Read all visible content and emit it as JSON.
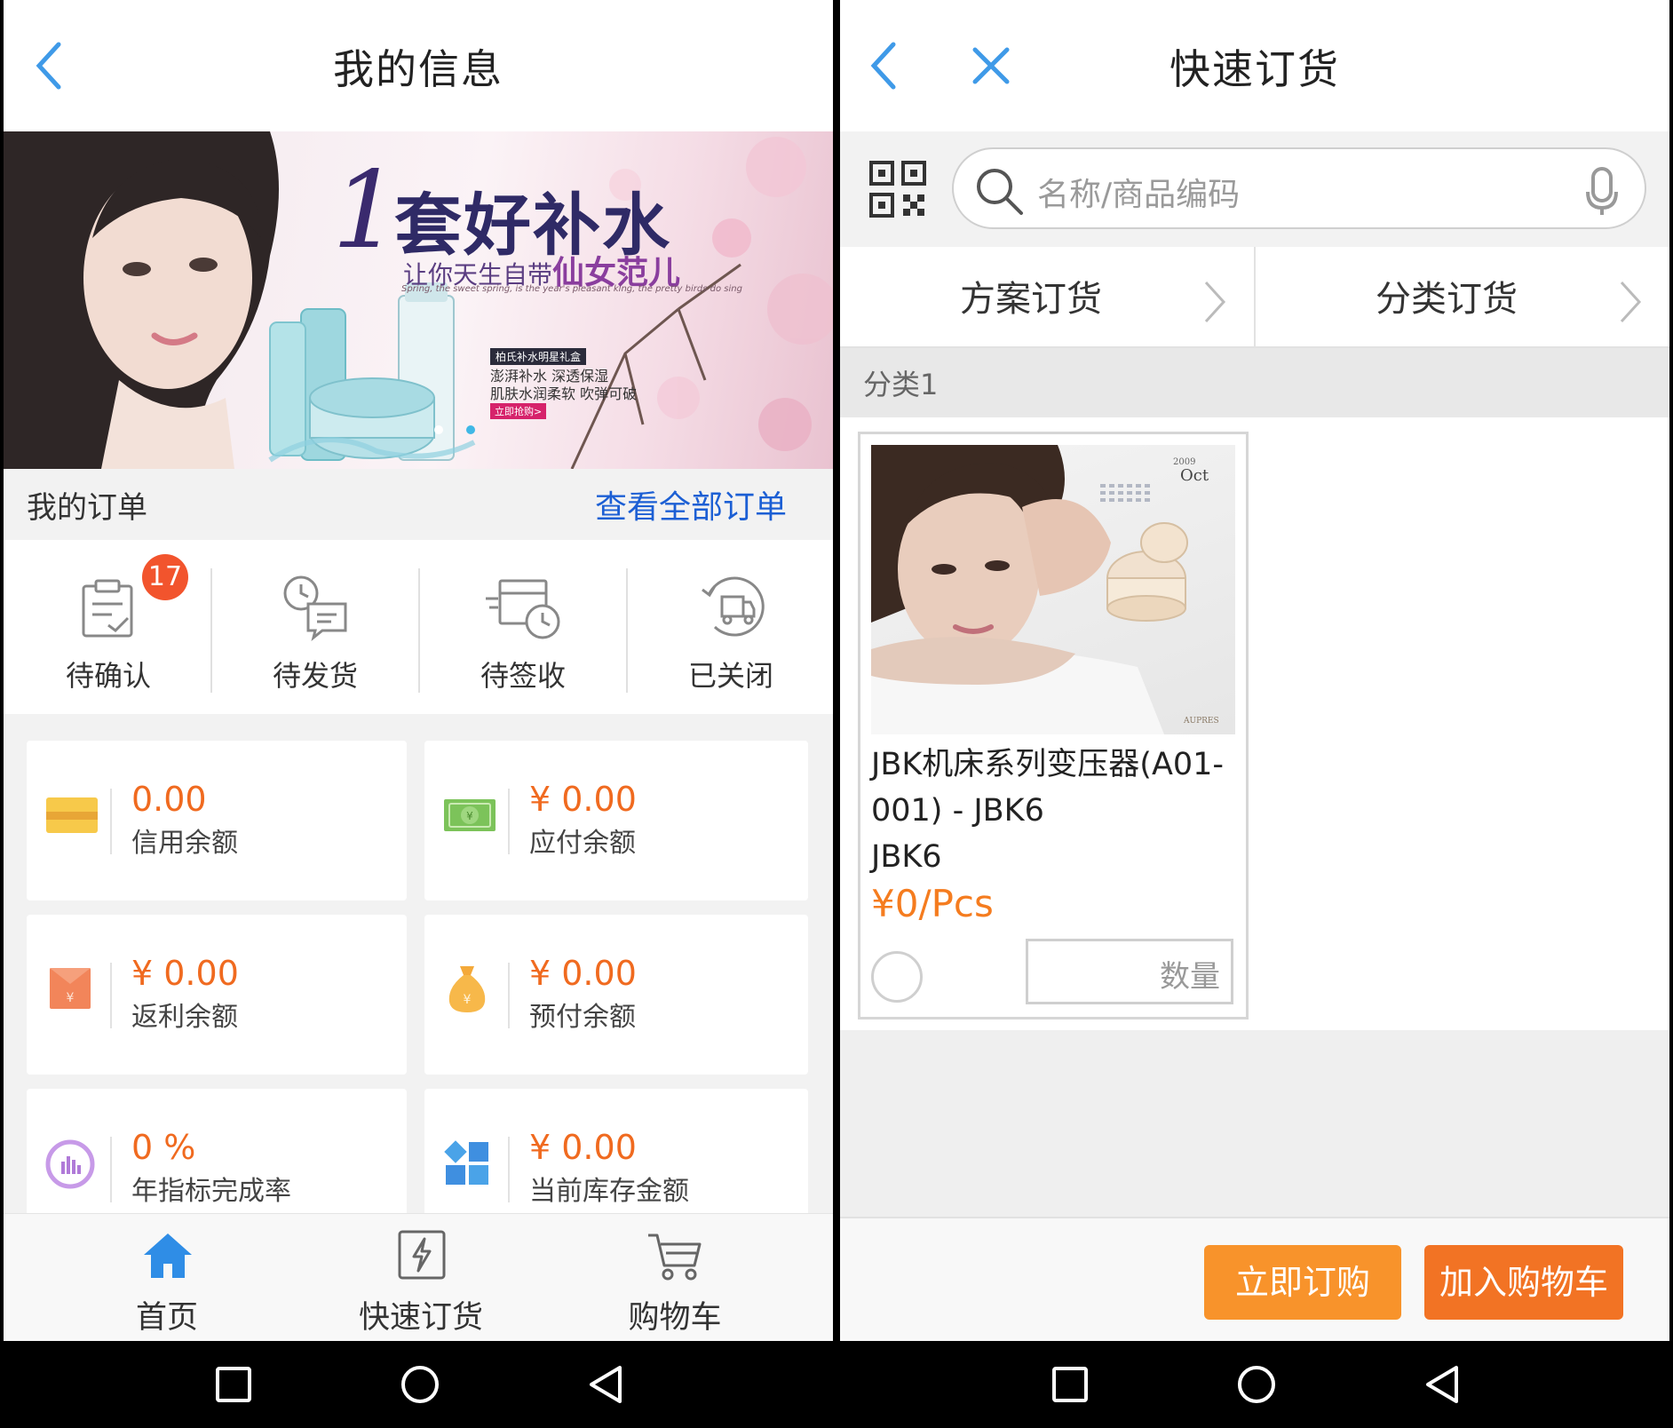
{
  "left": {
    "title": "我的信息",
    "banner": {
      "headline_number": "1",
      "headline": "套好补水",
      "tagline_a": "让你天生自带",
      "tagline_b": "仙女范儿",
      "small_line": "Spring, the sweet spring, is the year's pleasant king, the pretty birds do sing",
      "box_heading": "柏氏补水明星礼盒",
      "box_line1": "澎湃补水 深透保湿",
      "box_line2": "肌肤水润柔软 吹弹可破",
      "box_button": "立即抢购>"
    },
    "orders_header": {
      "title": "我的订单",
      "link": "查看全部订单"
    },
    "order_statuses": [
      {
        "label": "待确认",
        "icon": "clipboard-check-icon",
        "badge": "17"
      },
      {
        "label": "待发货",
        "icon": "clock-message-icon"
      },
      {
        "label": "待签收",
        "icon": "delivery-truck-clock-icon"
      },
      {
        "label": "已关闭",
        "icon": "truck-return-icon"
      }
    ],
    "balances": [
      {
        "value": "0.00",
        "label": "信用余额",
        "icon": "credit-card-icon"
      },
      {
        "value": "¥ 0.00",
        "label": "应付余额",
        "icon": "banknote-icon"
      },
      {
        "value": "¥ 0.00",
        "label": "返利余额",
        "icon": "red-envelope-icon"
      },
      {
        "value": "¥ 0.00",
        "label": "预付余额",
        "icon": "money-bag-icon"
      },
      {
        "value": "0 %",
        "label": "年指标完成率",
        "icon": "bar-chart-circle-icon"
      },
      {
        "value": "¥ 0.00",
        "label": "当前库存金额",
        "icon": "blocks-icon"
      }
    ],
    "tabbar": [
      {
        "label": "首页",
        "icon": "home-icon",
        "active": true
      },
      {
        "label": "快速订货",
        "icon": "lightning-doc-icon"
      },
      {
        "label": "购物车",
        "icon": "cart-icon"
      }
    ]
  },
  "right": {
    "title": "快速订货",
    "search": {
      "placeholder": "名称/商品编码"
    },
    "order_modes": [
      "方案订货",
      "分类订货"
    ],
    "category": "分类1",
    "product": {
      "name": "JBK机床系列变压器(A01-001) - JBK6",
      "code": "JBK6",
      "price": "¥0/Pcs",
      "qty_placeholder": "数量",
      "image_year": "2009",
      "image_month": "Oct",
      "image_brand": "AUPRES"
    },
    "buttons": {
      "buy_now": "立即订购",
      "add_cart": "加入购物车"
    }
  },
  "colors": {
    "accent_blue": "#3f9ae8",
    "orange": "#f57c1f",
    "orange_light": "#f8932b",
    "badge_red": "#f2542d",
    "link_blue": "#1c5fd4",
    "gray_bg": "#f2f2f2"
  }
}
